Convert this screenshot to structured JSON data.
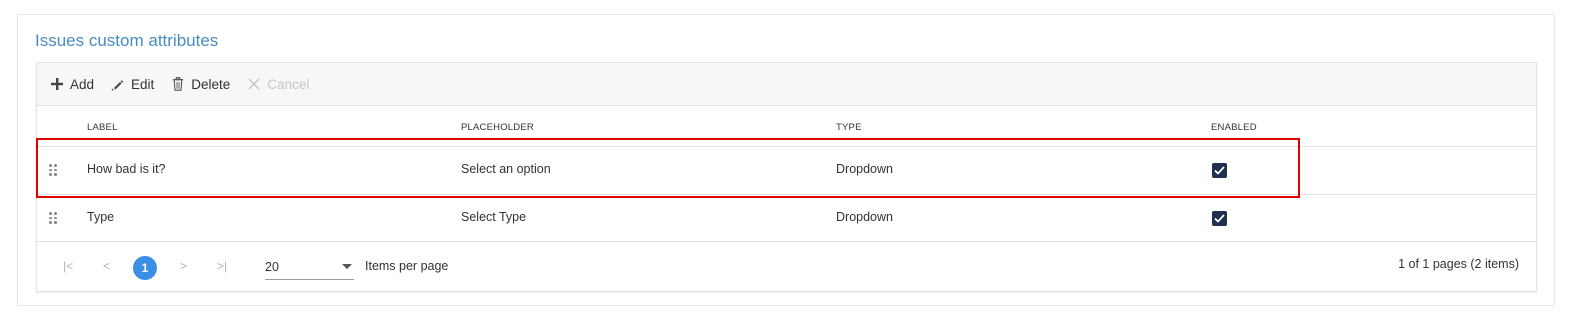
{
  "panel": {
    "title": "Issues custom attributes"
  },
  "toolbar": {
    "add_label": "Add",
    "edit_label": "Edit",
    "delete_label": "Delete",
    "cancel_label": "Cancel"
  },
  "table": {
    "columns": [
      "LABEL",
      "PLACEHOLDER",
      "TYPE",
      "ENABLED"
    ],
    "rows": [
      {
        "label": "How bad is it?",
        "placeholder": "Select an option",
        "type": "Dropdown",
        "enabled": true
      },
      {
        "label": "Type",
        "placeholder": "Select Type",
        "type": "Dropdown",
        "enabled": true
      }
    ]
  },
  "pager": {
    "first": "|<",
    "prev": "<",
    "current_page": "1",
    "next": ">",
    "last": ">|",
    "page_size": "20",
    "page_size_label": "Items per page",
    "info": "1 of 1 pages (2 items)"
  },
  "colors": {
    "title": "#4a8bc2",
    "checkbox": "#1f3050",
    "pager_active": "#3a8ee6",
    "highlight": "#e00000"
  },
  "icons": {
    "add": "plus-icon",
    "edit": "pencil-icon",
    "delete": "trash-icon",
    "cancel": "x-icon",
    "drag": "drag-handle-icon",
    "check": "checkmark-icon",
    "dropdown": "caret-down-icon"
  }
}
